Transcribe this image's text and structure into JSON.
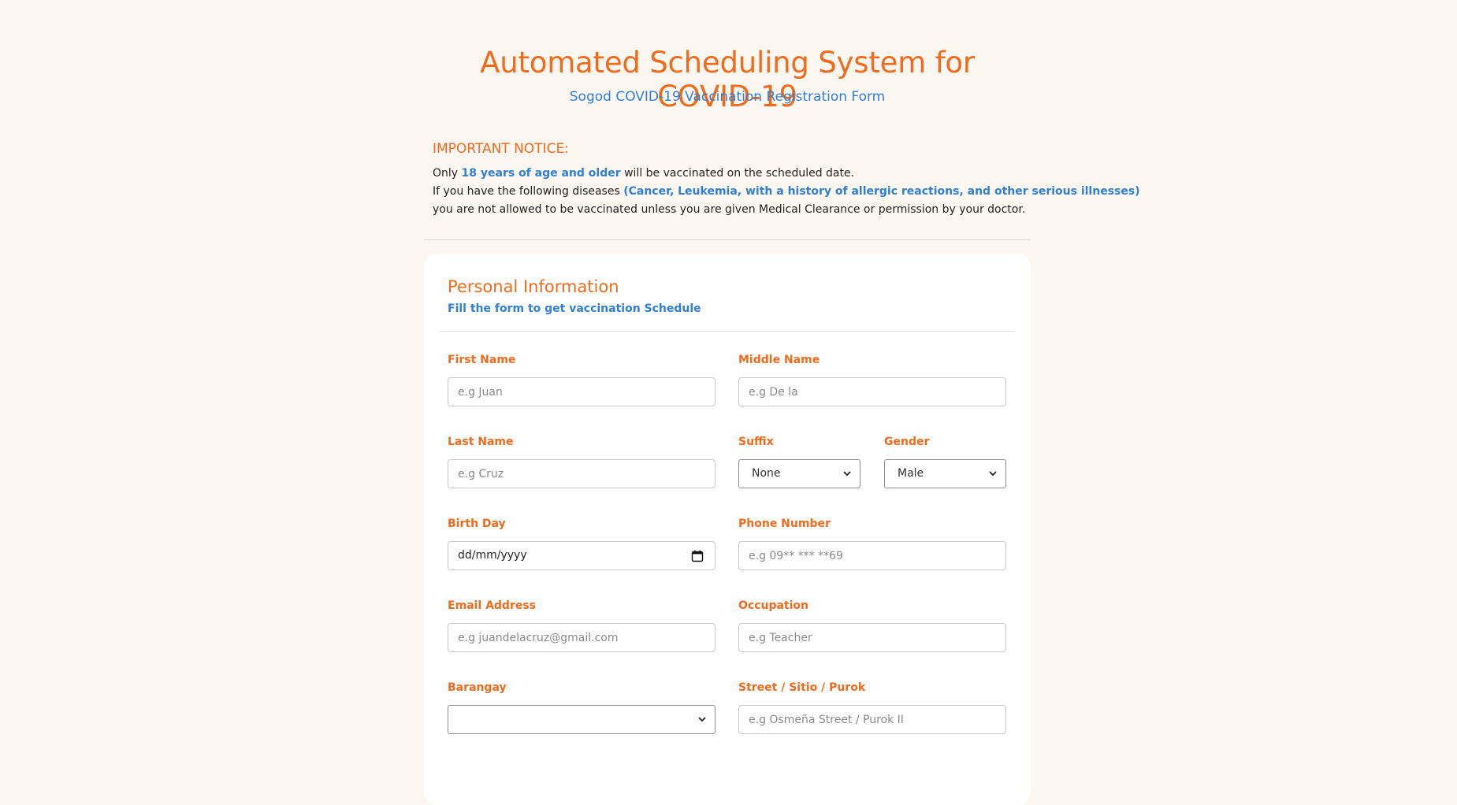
{
  "header": {
    "title": "Automated Scheduling System for COVID-19",
    "subtitle": "Sogod COVID-19 Vaccination Registration Form"
  },
  "notice": {
    "heading": "IMPORTANT NOTICE:",
    "line1_before": "Only ",
    "line1_highlight": "18 years of age and older",
    "line1_after": " will be vaccinated on the scheduled date.",
    "line2_before": "If you have the following diseases ",
    "line2_highlight": "(Cancer, Leukemia, with a history of allergic reactions, and other serious illnesses)",
    "line3": "you are not allowed to be vaccinated unless you are given Medical Clearance or permission by your doctor."
  },
  "card": {
    "title": "Personal Information",
    "subtitle": "Fill the form to get vaccination Schedule"
  },
  "form": {
    "first_name": {
      "label": "First Name",
      "placeholder": "e.g Juan",
      "value": ""
    },
    "middle_name": {
      "label": "Middle Name",
      "placeholder": "e.g De la",
      "value": ""
    },
    "last_name": {
      "label": "Last Name",
      "placeholder": "e.g Cruz",
      "value": ""
    },
    "suffix": {
      "label": "Suffix",
      "selected": "None"
    },
    "gender": {
      "label": "Gender",
      "selected": "Male"
    },
    "birthday": {
      "label": "Birth Day",
      "placeholder": "dd/mm/yyyy"
    },
    "phone": {
      "label": "Phone Number",
      "placeholder": "e.g 09** *** **69",
      "value": ""
    },
    "email": {
      "label": "Email Address",
      "placeholder": "e.g juandelacruz@gmail.com",
      "value": ""
    },
    "occupation": {
      "label": "Occupation",
      "placeholder": "e.g Teacher",
      "value": ""
    },
    "barangay": {
      "label": "Barangay",
      "selected": ""
    },
    "street": {
      "label": "Street / Sitio / Purok",
      "placeholder": "e.g Osmeña Street / Purok II",
      "value": ""
    }
  },
  "icons": {
    "select": "chevron-down-icon",
    "date": "calendar-icon"
  },
  "colors": {
    "background": "#fdf7f1",
    "accent_orange": "#f26b1d",
    "accent_blue": "#2f7fd6",
    "card": "#ffffff"
  }
}
